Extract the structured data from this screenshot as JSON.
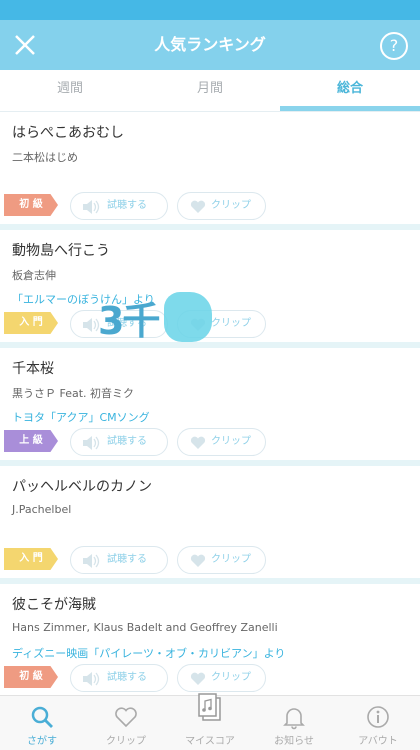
{
  "header": {
    "title": "人気ランキング",
    "help_label": "?"
  },
  "tabs": [
    {
      "label": "週間",
      "active": false
    },
    {
      "label": "月間",
      "active": false
    },
    {
      "label": "総合",
      "active": true
    }
  ],
  "items": [
    {
      "title": "はらぺこあおむし",
      "artist": "二本松はじめ",
      "note": "",
      "level": "初 級"
    },
    {
      "title": "動物島へ行こう",
      "artist": "板倉志伸",
      "note": "「エルマーのぼうけん」より",
      "level": "入 門"
    },
    {
      "title": "千本桜",
      "artist": "黒うさＰ Feat. 初音ミク",
      "note": "トヨタ「アクア」CMソング",
      "level": "上 級"
    },
    {
      "title": "パッヘルベルのカノン",
      "artist": "J.Pachelbel",
      "note": "",
      "level": "入 門"
    },
    {
      "title": "彼こそが海賊",
      "artist": "Hans Zimmer, Klaus Badelt and Geoffrey Zanelli",
      "note": "ディズニー映画「パイレーツ・オブ・カリビアン」より",
      "level": "初 級"
    }
  ],
  "buttons": {
    "listen_label": "試聴する",
    "clip_label": "クリップ"
  },
  "overlay": {
    "counter_text": "3千"
  },
  "tabbar": [
    {
      "label": "さがす",
      "icon": "search-icon",
      "active": true
    },
    {
      "label": "クリップ",
      "icon": "heart-icon",
      "active": false
    },
    {
      "label": "マイスコア",
      "icon": "score-icon",
      "active": false
    },
    {
      "label": "お知らせ",
      "icon": "bell-icon",
      "active": false
    },
    {
      "label": "アバウト",
      "icon": "info-icon",
      "active": false
    }
  ],
  "colors": {
    "statusbar": "#45b8e6",
    "navbar": "#84d1ec",
    "accent": "#4bb6d9",
    "level_beginner": "#ef9b82",
    "level_intro": "#f4d66f",
    "level_advanced": "#a98ed9"
  }
}
